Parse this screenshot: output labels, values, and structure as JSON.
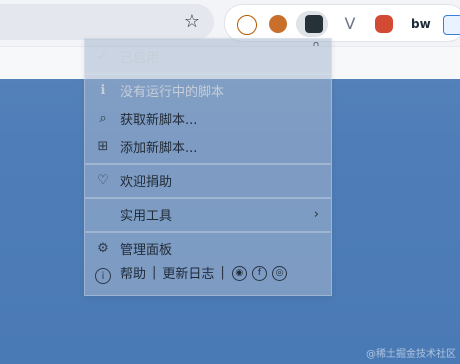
{
  "menu": {
    "enabled": "已启用",
    "no_scripts": "没有运行中的脚本",
    "get_scripts": "获取新脚本...",
    "add_script": "添加新脚本...",
    "donate": "欢迎捐助",
    "utilities": "实用工具",
    "dashboard": "管理面板",
    "help": "帮助",
    "changelog": "更新日志",
    "sep": "|"
  },
  "watermark": "@稀土掘金技术社区",
  "colors": {
    "accent": "#5b86bc"
  },
  "icons": [
    "star-icon",
    "extension-icons",
    "check-icon",
    "user-icon",
    "search-icon",
    "plus-box-icon",
    "heart-icon",
    "chevron-right-icon",
    "gear-icon",
    "info-icon",
    "github-icon",
    "facebook-icon",
    "instagram-icon"
  ]
}
